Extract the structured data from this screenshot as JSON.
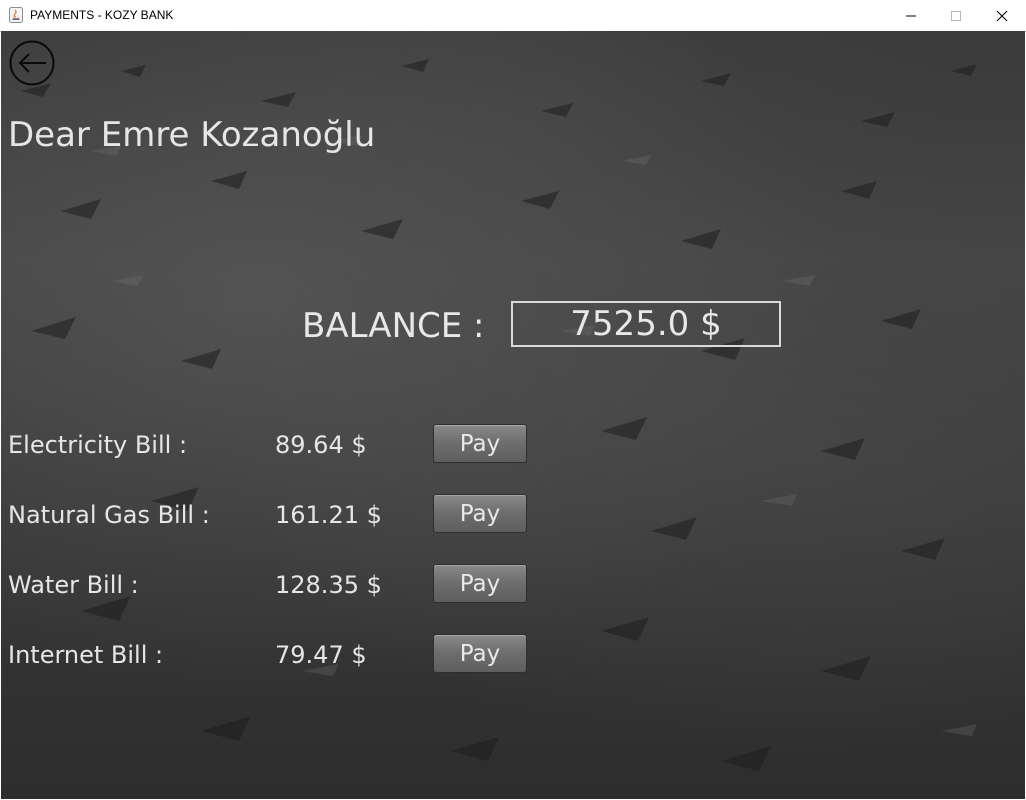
{
  "window": {
    "title": "PAYMENTS - KOZY BANK",
    "controls": {
      "minimize_icon": "minimize-icon",
      "maximize_icon": "maximize-icon",
      "close_icon": "close-icon"
    }
  },
  "header": {
    "back_icon": "back-arrow-icon",
    "greeting": "Dear Emre Kozanoğlu"
  },
  "balance": {
    "label": "BALANCE :",
    "value": "7525.0 $"
  },
  "bills": [
    {
      "label": "Electricity Bill :",
      "amount": "89.64 $",
      "button": "Pay"
    },
    {
      "label": "Natural Gas Bill :",
      "amount": "161.21 $",
      "button": "Pay"
    },
    {
      "label": "Water Bill :",
      "amount": "128.35 $",
      "button": "Pay"
    },
    {
      "label": "Internet Bill :",
      "amount": "79.47 $",
      "button": "Pay"
    }
  ],
  "colors": {
    "background": "#3a3a3a",
    "text": "#e6e6e6",
    "button": "#6f6f6f"
  }
}
